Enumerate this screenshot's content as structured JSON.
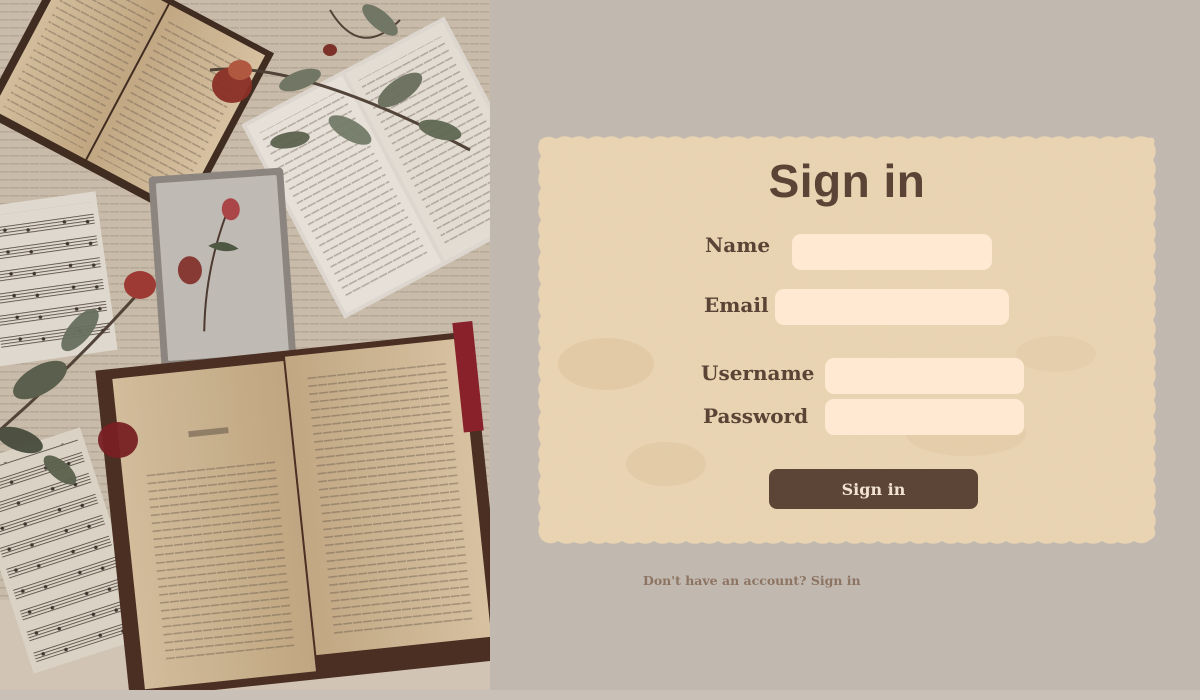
{
  "form": {
    "title": "Sign in",
    "name_label": "Name",
    "email_label": "Email",
    "username_label": "Username",
    "password_label": "Password",
    "name_value": "",
    "email_value": "",
    "username_value": "",
    "password_value": "",
    "submit_label": "Sign in"
  },
  "footer": {
    "prompt": "Don't have an account?",
    "link_label": "Sign in"
  },
  "colors": {
    "background": "#c1b8b0",
    "paper": "#ead3b0",
    "accent": "#5c4436",
    "field": "#ffe9d2",
    "muted_text": "#8d7462"
  }
}
